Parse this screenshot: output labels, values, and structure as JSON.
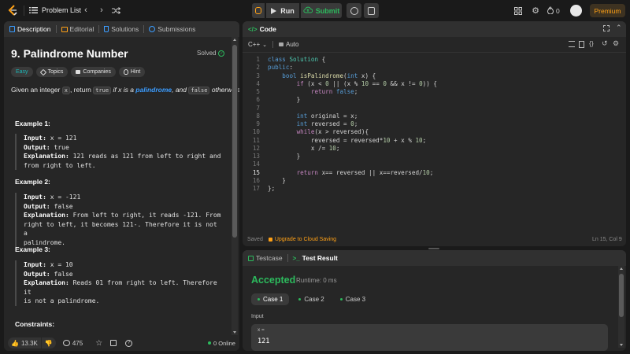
{
  "topbar": {
    "problem_list_label": "Problem List",
    "run_label": "Run",
    "submit_label": "Submit",
    "streak_count": "0",
    "premium_label": "Premium"
  },
  "left_panel": {
    "tabs": [
      {
        "label": "Description",
        "icon": "description-icon"
      },
      {
        "label": "Editorial",
        "icon": "book-icon"
      },
      {
        "label": "Solutions",
        "icon": "flask-icon"
      },
      {
        "label": "Submissions",
        "icon": "history-icon"
      }
    ],
    "title": "9. Palindrome Number",
    "status": "Solved",
    "tags": {
      "difficulty": "Easy",
      "topics": "Topics",
      "companies": "Companies",
      "hint": "Hint"
    },
    "statement": {
      "pre": "Given an integer ",
      "var_x": "x",
      "mid": ", return ",
      "true_code": "true",
      "if_x_is_a": " if x is a ",
      "palindrome": "palindrome",
      "and": ", and ",
      "false_code": "false",
      "otherwise": " otherwise."
    },
    "examples": [
      {
        "title": "Example 1:",
        "input_label": "Input:",
        "input": " x = 121",
        "output_label": "Output:",
        "output": " true",
        "explanation_label": "Explanation:",
        "explanation_1": " 121 reads as 121 from left to right and",
        "explanation_2": "from right to left."
      },
      {
        "title": "Example 2:",
        "input_label": "Input:",
        "input": " x = -121",
        "output_label": "Output:",
        "output": " false",
        "explanation_label": "Explanation:",
        "explanation_1": " From left to right, it reads -121. From",
        "explanation_2": "right to left, it becomes 121-. Therefore it is not a",
        "explanation_3": "palindrome."
      },
      {
        "title": "Example 3:",
        "input_label": "Input:",
        "input": " x = 10",
        "output_label": "Output:",
        "output": " false",
        "explanation_label": "Explanation:",
        "explanation_1": " Reads 01 from right to left. Therefore it",
        "explanation_2": "is not a palindrome."
      }
    ],
    "constraints_title": "Constraints:",
    "footer": {
      "likes": "13.3K",
      "comments": "475",
      "online": "0 Online"
    }
  },
  "code_panel": {
    "title": "Code",
    "language": "C++",
    "auto_label": "Auto",
    "lines": [
      {
        "n": "1",
        "t": "class Solution {"
      },
      {
        "n": "2",
        "t": "public:"
      },
      {
        "n": "3",
        "t": "    bool isPalindrome(int x) {"
      },
      {
        "n": "4",
        "t": "        if (x < 0 || (x % 10 == 0 && x != 0)) {"
      },
      {
        "n": "5",
        "t": "            return false;"
      },
      {
        "n": "6",
        "t": "        }"
      },
      {
        "n": "7",
        "t": ""
      },
      {
        "n": "8",
        "t": "        int original = x;"
      },
      {
        "n": "9",
        "t": "        int reversed = 0;"
      },
      {
        "n": "10",
        "t": "        while(x > reversed){"
      },
      {
        "n": "11",
        "t": "            reversed = reversed*10 + x % 10;"
      },
      {
        "n": "12",
        "t": "            x /= 10;"
      },
      {
        "n": "13",
        "t": "        }"
      },
      {
        "n": "14",
        "t": ""
      },
      {
        "n": "15",
        "t": "        return x== reversed || x==reversed/10;"
      },
      {
        "n": "16",
        "t": "    }"
      },
      {
        "n": "17",
        "t": "};"
      }
    ],
    "saved_label": "Saved",
    "upgrade_label": "Upgrade to Cloud Saving",
    "cursor_pos": "Ln 15, Col 9"
  },
  "result_panel": {
    "testcase_tab": "Testcase",
    "result_tab": "Test Result",
    "status": "Accepted",
    "runtime": "Runtime: 0 ms",
    "cases": [
      "Case 1",
      "Case 2",
      "Case 3"
    ],
    "input_label": "Input",
    "input_var": "x =",
    "input_value": "121"
  },
  "colors": {
    "accent_green": "#2cbb5d",
    "premium": "#ffa116",
    "link_blue": "#3b9cff"
  }
}
